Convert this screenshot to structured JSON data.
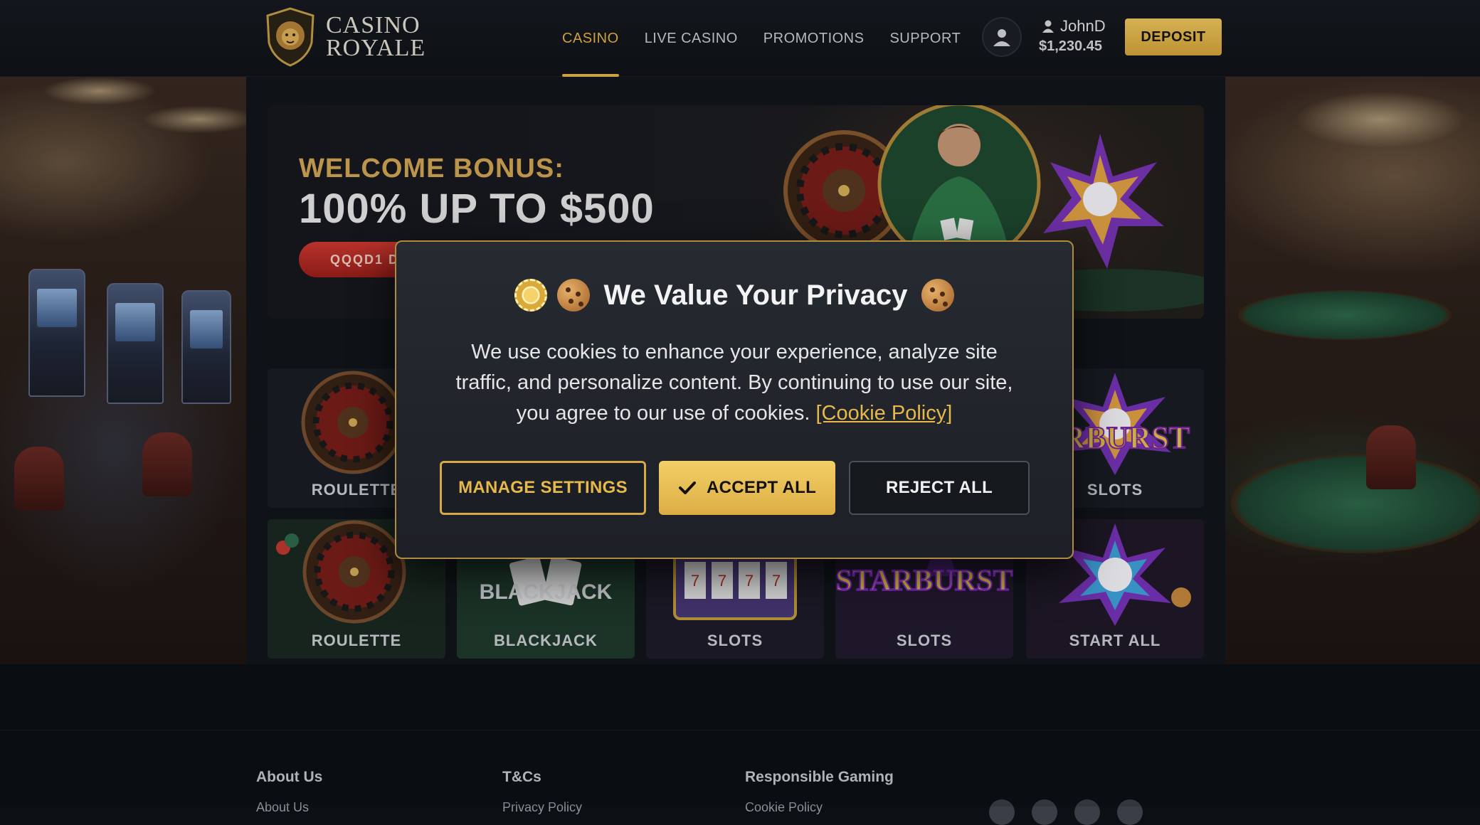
{
  "brand": {
    "name_line1": "CASINO",
    "name_line2": "ROYALE"
  },
  "nav": {
    "items": [
      {
        "label": "CASINO",
        "active": true
      },
      {
        "label": "LIVE CASINO",
        "active": false
      },
      {
        "label": "PROMOTIONS",
        "active": false
      },
      {
        "label": "SUPPORT",
        "active": false
      }
    ]
  },
  "user": {
    "name": "JohnD",
    "balance": "$1,230.45",
    "icon": "user-icon"
  },
  "header": {
    "deposit_label": "DEPOSIT"
  },
  "hero": {
    "subtitle": "WELCOME BONUS:",
    "title": "100% UP TO $500",
    "cta_label": "QQQD1 D"
  },
  "games": {
    "tiles": [
      {
        "label": "ROULETTE",
        "art": "roulette"
      },
      {
        "label": "SLOTS",
        "art": "starburst"
      },
      {
        "label": "ROULETTE",
        "art": "roulette"
      },
      {
        "label": "BLACKJACK",
        "art": "blackjack",
        "art_text": "BLACKJACK"
      },
      {
        "label": "SLOTS",
        "art": "slot-machine"
      },
      {
        "label": "SLOTS",
        "art": "starburst",
        "art_text": "STARBURST"
      },
      {
        "label": "START ALL",
        "art": "starburst"
      }
    ],
    "partial_art_text": "ARBURST"
  },
  "cookie_modal": {
    "title": "We Value Your Privacy",
    "body": "We use cookies to enhance your experience, analyze site traffic, and personalize content. By continuing to use our site, you agree to our use of cookies.",
    "policy_link": "[Cookie Policy]",
    "manage_label": "MANAGE SETTINGS",
    "accept_label": "ACCEPT ALL",
    "reject_label": "REJECT ALL"
  },
  "footer": {
    "columns": [
      {
        "heading": "About Us",
        "link": "About Us"
      },
      {
        "heading": "T&Cs",
        "link": "Privacy Policy"
      },
      {
        "heading": "Responsible Gaming",
        "link": "Cookie Policy"
      }
    ]
  },
  "colors": {
    "accent_gold": "#e7b84a",
    "header_bg": "#14181d",
    "modal_border": "#b08a3e",
    "cta_red": "#c22f29"
  }
}
